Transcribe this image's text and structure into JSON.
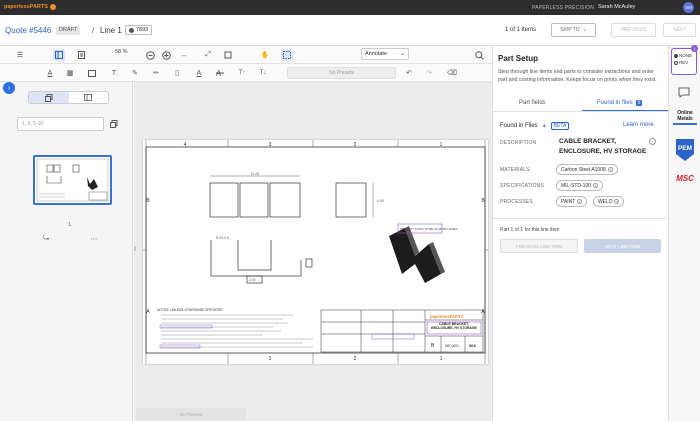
{
  "topbar": {
    "brand": "paperlessPARTS",
    "org": "PAPERLESS PRECISION",
    "user": "Sarah McAuley",
    "initials": "SM"
  },
  "header": {
    "quote": "Quote #5446",
    "status": "DRAFT",
    "separator": "/",
    "line": "Line 1",
    "part_number": "7893",
    "items_count": "1 of 1 items",
    "skip_label": "SKIP TO",
    "prev_label": "PREVIOUS",
    "next_label": "NEXT"
  },
  "toolbar": {
    "zoom": "58 %",
    "mode": "Annotate",
    "presets_placeholder": "No Presets",
    "presets_bottom": "No Presets"
  },
  "sidebar": {
    "page_range_placeholder": "1, 3, 5-10",
    "page_number": "1"
  },
  "drawing": {
    "col_labels": [
      "4",
      "3",
      "2",
      "1"
    ],
    "row_labels": [
      "B",
      "A"
    ],
    "dim_top": "11.00",
    "dim_side": "4.00",
    "dim_bend": "R.25 X 6",
    "dim_mid": "2.00",
    "note_title": "NOTES: UNLESS OTHERWISE SPECIFIED",
    "callout": "PROJECT CLIPS TO BE ON BOTH SIDES",
    "tb_company": "paperlessPARTS",
    "tb_title": "CABLE BRACKET, ENCLOSURE, HV STORAGE",
    "tb_size": "B",
    "tb_dwg": "087-0001",
    "tb_rev": "003"
  },
  "panel": {
    "title": "Part Setup",
    "description": "Step through line items and parts to consider extractions and enter part and costing information. Keeps focus on prints when they exist.",
    "tab_fields": "Part fields",
    "tab_found": "Found in files",
    "tab_found_count": "5",
    "found_title": "Found in Files",
    "beta": "BETA",
    "learn_more": "Learn more",
    "fields": {
      "description_label": "DESCRIPTION",
      "description_value": "CABLE BRACKET, ENCLOSURE, HV STORAGE",
      "materials_label": "MATERIALS",
      "materials_value": "Carbon Steel A1008",
      "specs_label": "SPECIFICATIONS",
      "specs_value": "MIL-STD-100",
      "processes_label": "PROCESSES",
      "processes": [
        "PAINT",
        "WELD"
      ]
    },
    "part_of": "Part 1 of 1 for this line item",
    "prev_line": "PREVIOUS LINE ITEM",
    "next_line": "NEXT LINE ITEM"
  },
  "rail": {
    "opt_a": "NONE",
    "opt_b": "REV",
    "badge": "1",
    "online_metals": "Online Metals",
    "pem": "PEM",
    "msc": "MSC"
  },
  "colors": {
    "accent": "#2c6fde",
    "link": "#2c5fcf",
    "brand": "#f08c2a",
    "topbar": "#2d2d2d",
    "purple": "#8a5ad8",
    "msc": "#d6202c"
  }
}
